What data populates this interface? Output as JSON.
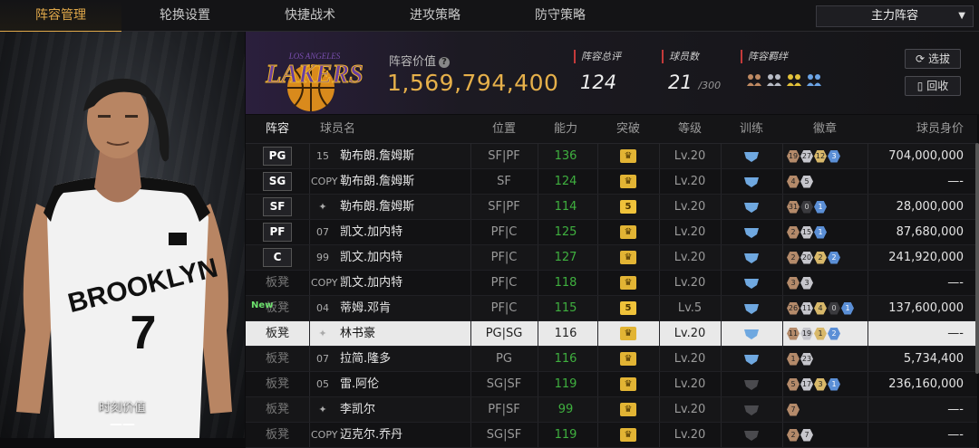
{
  "tabs": [
    "阵容管理",
    "轮换设置",
    "快捷战术",
    "进攻策略",
    "防守策略"
  ],
  "active_tab": 0,
  "lineup_select": "主力阵容",
  "player_panel": {
    "moment_label": "时刻价值",
    "moment_value": "——"
  },
  "team": {
    "logo_text": "LAKERS",
    "logo_subtext": "LOS ANGELES",
    "value_label": "阵容价值",
    "value": "1,569,794,400",
    "stats": [
      {
        "label": "阵容总评",
        "value": "124",
        "suffix": ""
      },
      {
        "label": "球员数",
        "value": "21",
        "suffix": "/300"
      },
      {
        "label": "阵容羁绊",
        "value": "",
        "suffix": ""
      }
    ],
    "buttons": {
      "select": "选拔",
      "recycle": "回收"
    }
  },
  "table": {
    "headers": [
      "阵容",
      "球员名",
      "位置",
      "能力",
      "突破",
      "等级",
      "训练",
      "徽章",
      "球员身价"
    ],
    "rows": [
      {
        "slot": "PG",
        "slot_type": "starter",
        "number": "15",
        "name": "勒布朗.詹姆斯",
        "positions": "SF|PF",
        "rating": "136",
        "rating_green": true,
        "break": "crown",
        "level": "Lv.20",
        "train": "on",
        "badges": [
          [
            "bronze",
            "19"
          ],
          [
            "silver",
            "27"
          ],
          [
            "gold",
            "12"
          ],
          [
            "blue",
            "3"
          ]
        ],
        "value": "704,000,000"
      },
      {
        "slot": "SG",
        "slot_type": "starter",
        "number": "COPY",
        "name": "勒布朗.詹姆斯",
        "positions": "SF",
        "rating": "124",
        "rating_green": true,
        "break": "crown",
        "level": "Lv.20",
        "train": "on",
        "badges": [
          [
            "bronze",
            "4"
          ],
          [
            "silver",
            "5"
          ]
        ],
        "value": "—-"
      },
      {
        "slot": "SF",
        "slot_type": "starter",
        "number": "",
        "name": "勒布朗.詹姆斯",
        "positions": "SF|PF",
        "rating": "114",
        "rating_green": true,
        "break": "5",
        "level": "Lv.20",
        "train": "on",
        "badges": [
          [
            "bronze",
            "31"
          ],
          [
            "dark",
            "0"
          ],
          [
            "blue",
            "1"
          ]
        ],
        "value": "28,000,000"
      },
      {
        "slot": "PF",
        "slot_type": "starter",
        "number": "07",
        "name": "凯文.加内特",
        "positions": "PF|C",
        "rating": "125",
        "rating_green": true,
        "break": "crown",
        "level": "Lv.20",
        "train": "on",
        "badges": [
          [
            "bronze",
            "2"
          ],
          [
            "silver",
            "15"
          ],
          [
            "blue",
            "1"
          ]
        ],
        "value": "87,680,000"
      },
      {
        "slot": "C",
        "slot_type": "starter",
        "number": "99",
        "name": "凯文.加内特",
        "positions": "PF|C",
        "rating": "127",
        "rating_green": true,
        "break": "crown",
        "level": "Lv.20",
        "train": "on",
        "badges": [
          [
            "bronze",
            "2"
          ],
          [
            "silver",
            "20"
          ],
          [
            "gold",
            "2"
          ],
          [
            "blue",
            "2"
          ]
        ],
        "value": "241,920,000"
      },
      {
        "slot": "板凳",
        "slot_type": "bench",
        "number": "COPY",
        "name": "凯文.加内特",
        "positions": "PF|C",
        "rating": "118",
        "rating_green": true,
        "break": "crown",
        "level": "Lv.20",
        "train": "on",
        "badges": [
          [
            "bronze",
            "3"
          ],
          [
            "silver",
            "3"
          ]
        ],
        "value": "—-"
      },
      {
        "slot": "板凳",
        "slot_type": "bench",
        "new": "New",
        "number": "04",
        "name": "蒂姆.邓肯",
        "positions": "PF|C",
        "rating": "115",
        "rating_green": true,
        "break": "5",
        "level": "Lv.5",
        "train": "on",
        "badges": [
          [
            "bronze",
            "26"
          ],
          [
            "silver",
            "11"
          ],
          [
            "gold",
            "4"
          ],
          [
            "dark",
            "0"
          ],
          [
            "blue",
            "1"
          ]
        ],
        "value": "137,600,000"
      },
      {
        "slot": "板凳",
        "slot_type": "bench",
        "selected": true,
        "number": "",
        "name": "林书豪",
        "positions": "PG|SG",
        "rating": "116",
        "rating_green": false,
        "break": "crown",
        "level": "Lv.20",
        "train": "on",
        "badges": [
          [
            "bronze",
            "11"
          ],
          [
            "silver",
            "19"
          ],
          [
            "gold",
            "1"
          ],
          [
            "blue",
            "2"
          ]
        ],
        "value": "—-"
      },
      {
        "slot": "板凳",
        "slot_type": "bench",
        "number": "07",
        "name": "拉简.隆多",
        "positions": "PG",
        "rating": "116",
        "rating_green": true,
        "break": "crown",
        "level": "Lv.20",
        "train": "on",
        "badges": [
          [
            "bronze",
            "1"
          ],
          [
            "silver",
            "23"
          ]
        ],
        "value": "5,734,400"
      },
      {
        "slot": "板凳",
        "slot_type": "bench",
        "number": "05",
        "name": "雷.阿伦",
        "positions": "SG|SF",
        "rating": "119",
        "rating_green": true,
        "break": "crown",
        "level": "Lv.20",
        "train": "off",
        "badges": [
          [
            "bronze",
            "5"
          ],
          [
            "silver",
            "17"
          ],
          [
            "gold",
            "3"
          ],
          [
            "blue",
            "1"
          ]
        ],
        "value": "236,160,000"
      },
      {
        "slot": "板凳",
        "slot_type": "bench",
        "number": "",
        "name": "李凯尔",
        "positions": "PF|SF",
        "rating": "99",
        "rating_green": true,
        "break": "crown",
        "level": "Lv.20",
        "train": "off",
        "badges": [
          [
            "bronze",
            "7"
          ]
        ],
        "value": "—-"
      },
      {
        "slot": "板凳",
        "slot_type": "bench",
        "number": "COPY",
        "name": "迈克尔.乔丹",
        "positions": "SG|SF",
        "rating": "119",
        "rating_green": true,
        "break": "crown",
        "level": "Lv.20",
        "train": "off",
        "badges": [
          [
            "bronze",
            "2"
          ],
          [
            "silver",
            "7"
          ]
        ],
        "value": "—-"
      }
    ]
  }
}
